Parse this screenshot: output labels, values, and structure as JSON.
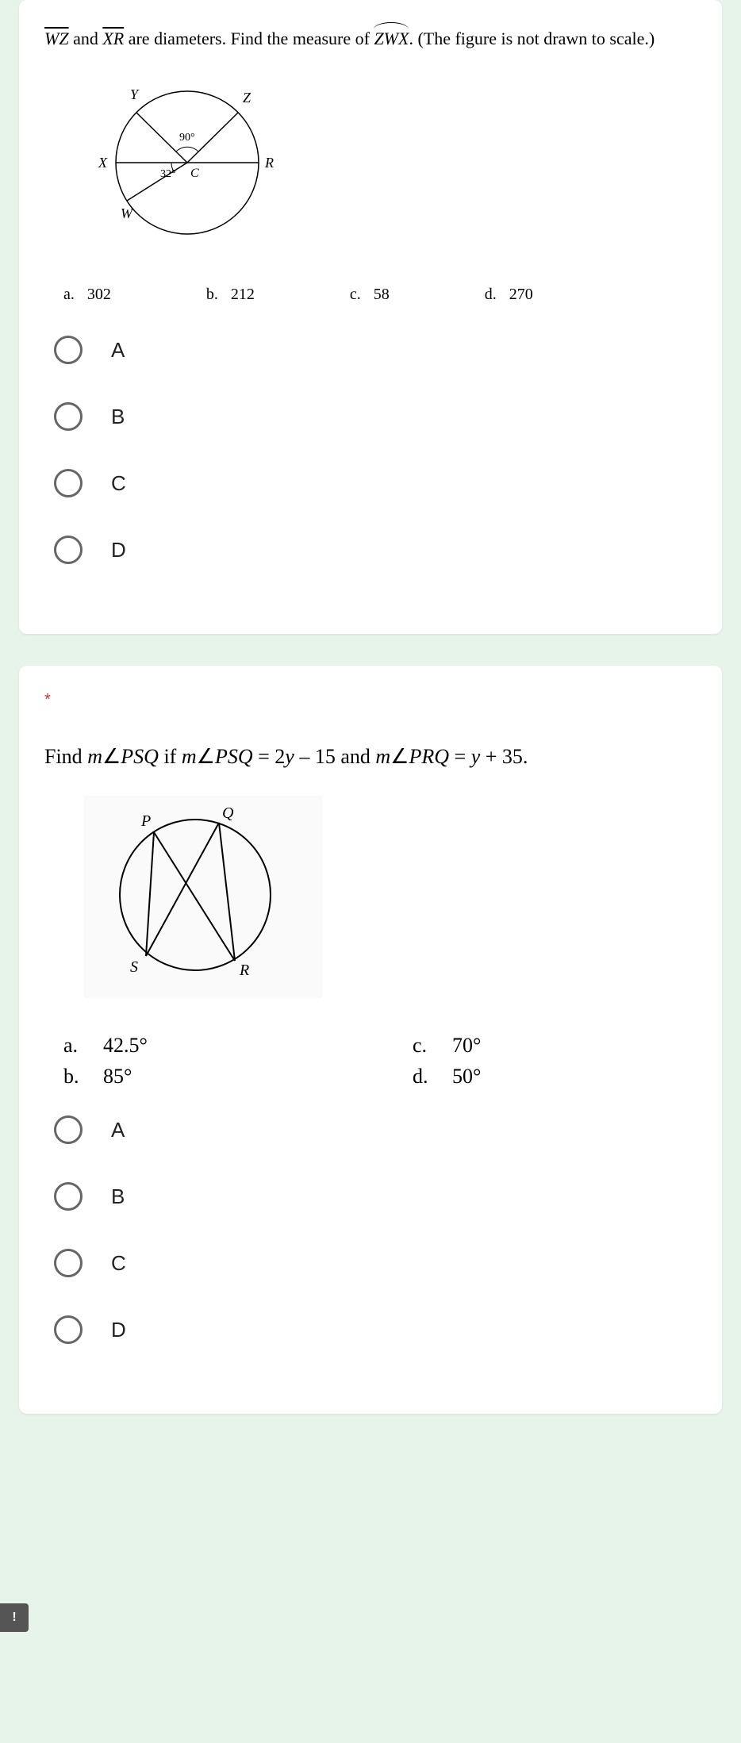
{
  "q1": {
    "prompt_pre": "WZ",
    "prompt_mid1": " and ",
    "prompt_xr": "XR",
    "prompt_mid2": " are diameters. Find the measure of ",
    "prompt_arc": "ZWX",
    "prompt_post": ". (The figure is not drawn to scale.)",
    "figure": {
      "Y": "Y",
      "Z": "Z",
      "X": "X",
      "R": "R",
      "W": "W",
      "C": "C",
      "angle90": "90°",
      "angle32": "32°"
    },
    "answers": {
      "a_l": "a.",
      "a_v": "302",
      "b_l": "b.",
      "b_v": "212",
      "c_l": "c.",
      "c_v": "58",
      "d_l": "d.",
      "d_v": "270"
    },
    "options": {
      "A": "A",
      "B": "B",
      "C": "C",
      "D": "D"
    }
  },
  "q2": {
    "required": "*",
    "prompt_pre": "Find ",
    "prompt_m1": "m",
    "prompt_ang1": "∠",
    "prompt_psq1": "PSQ",
    "prompt_if": " if ",
    "prompt_m2": "m",
    "prompt_ang2": "∠",
    "prompt_psq2": "PSQ",
    "prompt_eq1": " = 2",
    "prompt_y1": "y",
    "prompt_mid": " – 15 and ",
    "prompt_m3": "m",
    "prompt_ang3": "∠",
    "prompt_prq": "PRQ",
    "prompt_eq2": " = ",
    "prompt_y2": "y",
    "prompt_post": " + 35.",
    "figure": {
      "P": "P",
      "Q": "Q",
      "S": "S",
      "R": "R"
    },
    "answers": {
      "a_l": "a.",
      "a_v": "42.5°",
      "b_l": "b.",
      "b_v": "85°",
      "c_l": "c.",
      "c_v": "70°",
      "d_l": "d.",
      "d_v": "50°"
    },
    "options": {
      "A": "A",
      "B": "B",
      "C": "C",
      "D": "D"
    }
  },
  "alert": "!"
}
